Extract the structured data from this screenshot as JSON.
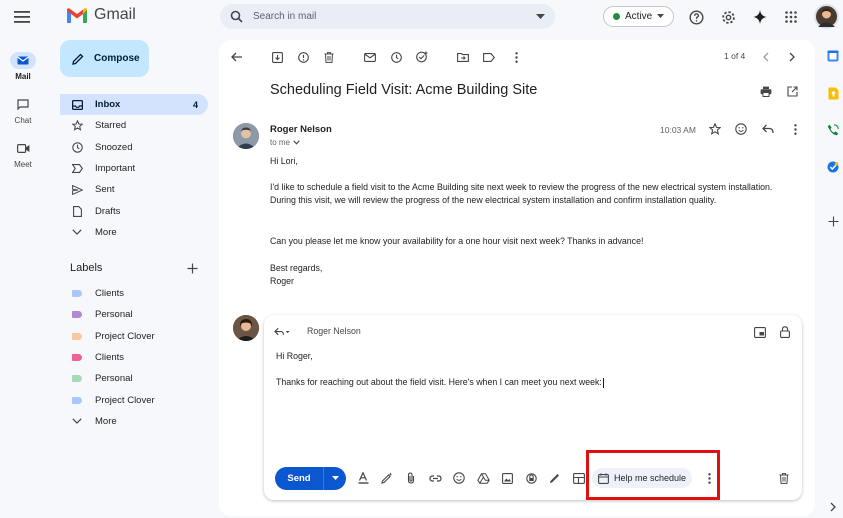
{
  "app": {
    "name": "Gmail"
  },
  "search": {
    "placeholder": "Search in mail"
  },
  "status": {
    "label": "Active"
  },
  "rail": [
    {
      "label": "Mail"
    },
    {
      "label": "Chat"
    },
    {
      "label": "Meet"
    }
  ],
  "compose": {
    "label": "Compose"
  },
  "nav": [
    {
      "label": "Inbox",
      "count": "4",
      "icon": "inbox-icon"
    },
    {
      "label": "Starred",
      "icon": "star-icon"
    },
    {
      "label": "Snoozed",
      "icon": "clock-icon"
    },
    {
      "label": "Important",
      "icon": "important-icon"
    },
    {
      "label": "Sent",
      "icon": "send-icon"
    },
    {
      "label": "Drafts",
      "icon": "draft-icon"
    },
    {
      "label": "More",
      "icon": "chevron-down-icon"
    }
  ],
  "labels": {
    "title": "Labels",
    "items": [
      {
        "label": "Clients",
        "color": "#a8c7fa"
      },
      {
        "label": "Personal",
        "color": "#b388d4"
      },
      {
        "label": "Project Clover",
        "color": "#f6c9a0"
      },
      {
        "label": "Clients",
        "color": "#f06292"
      },
      {
        "label": "Personal",
        "color": "#a8dab5"
      },
      {
        "label": "Project Clover",
        "color": "#a8c7fa"
      }
    ],
    "more": "More"
  },
  "toolbar": {
    "pager": "1 of 4"
  },
  "email": {
    "subject": "Scheduling Field Visit: Acme Building Site",
    "sender": "Roger Nelson",
    "to": "to me",
    "time": "10:03 AM",
    "greeting": "Hi Lori,",
    "para1": "I'd like to schedule a field visit to the Acme Building site next week to review the progress of the new electrical system installation. During this visit, we will review the progress of the new electrical system installation and confirm installation quality.",
    "para2": "Can you please let me know your availability for a one hour visit next week? Thanks in advance!",
    "signoff": "Best regards,",
    "signature": "Roger"
  },
  "reply": {
    "to": "Roger Nelson",
    "greeting": "Hi Roger,",
    "text": "Thanks for reaching out about the field visit. Here's when I can meet you next week:",
    "send_label": "Send",
    "help_label": "Help me schedule"
  },
  "colors": {
    "accent": "#0b57d0",
    "compose_bg": "#c2e7ff",
    "nav_active": "#d3e3fd",
    "highlight": "#e01010"
  }
}
